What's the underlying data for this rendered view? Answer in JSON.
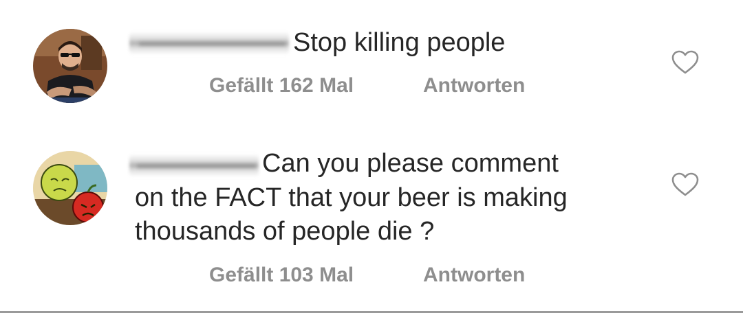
{
  "comments": [
    {
      "avatar_icon": "profile-photo-man-sunglasses",
      "text": "Stop killing people",
      "likes_label": "Gefällt 162 Mal",
      "reply_label": "Antworten",
      "like_icon": "heart-outline-icon"
    },
    {
      "avatar_icon": "profile-photo-cartoon-fruit",
      "text_lines": [
        "Can you please comment",
        "on the FACT that your beer is making",
        "thousands of people die ?"
      ],
      "likes_label": "Gefällt 103 Mal",
      "reply_label": "Antworten",
      "like_icon": "heart-outline-icon"
    }
  ],
  "colors": {
    "text": "#262626",
    "meta": "#8e8e8e",
    "heart_stroke": "#8e8e8e"
  }
}
